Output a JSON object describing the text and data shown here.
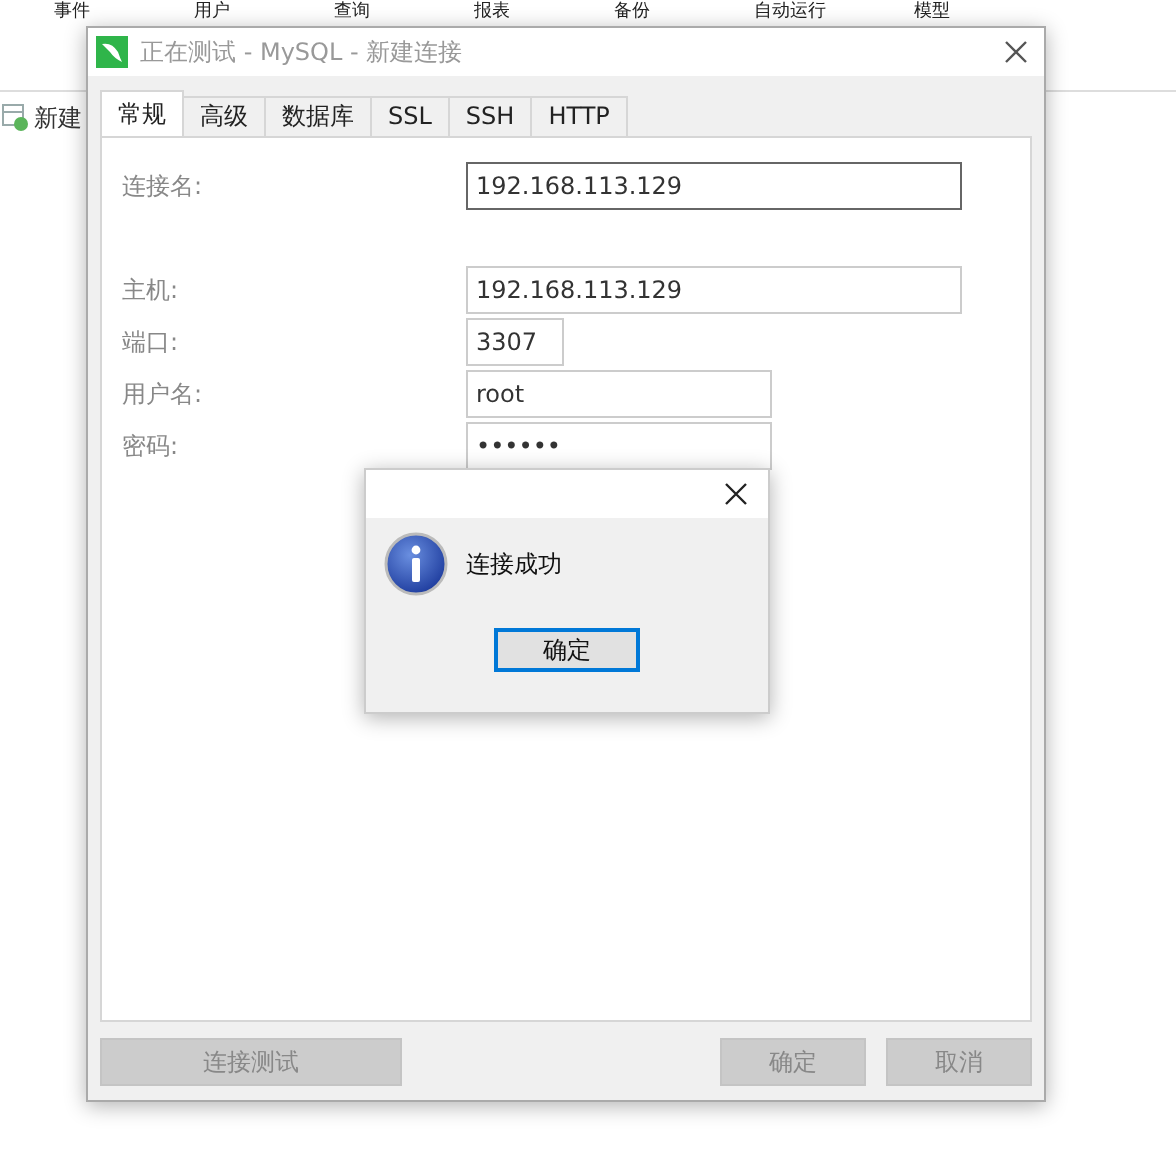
{
  "background": {
    "menu": [
      "事件",
      "用户",
      "查询",
      "报表",
      "备份",
      "自动运行",
      "模型"
    ],
    "toolbar_item": "新建"
  },
  "dialog": {
    "title": "正在测试 - MySQL - 新建连接",
    "tabs": [
      {
        "label": "常规",
        "selected": true
      },
      {
        "label": "高级",
        "selected": false
      },
      {
        "label": "数据库",
        "selected": false
      },
      {
        "label": "SSL",
        "selected": false
      },
      {
        "label": "SSH",
        "selected": false
      },
      {
        "label": "HTTP",
        "selected": false
      }
    ],
    "fields": [
      {
        "label": "连接名:",
        "value": "192.168.113.129",
        "focused": true
      },
      {
        "label": "主机:",
        "value": "192.168.113.129",
        "focused": false
      },
      {
        "label": "端口:",
        "value": "3307",
        "focused": false
      },
      {
        "label": "用户名:",
        "value": "root",
        "focused": false
      },
      {
        "label": "密码:",
        "value": "••••••",
        "focused": false
      }
    ],
    "buttons": [
      {
        "label": "连接测试",
        "kind": "test",
        "disabled": true
      },
      {
        "label": "确定",
        "kind": "ok",
        "disabled": true
      },
      {
        "label": "取消",
        "kind": "cancel",
        "disabled": true
      }
    ]
  },
  "message_box": {
    "message": "连接成功",
    "button": "确定"
  }
}
